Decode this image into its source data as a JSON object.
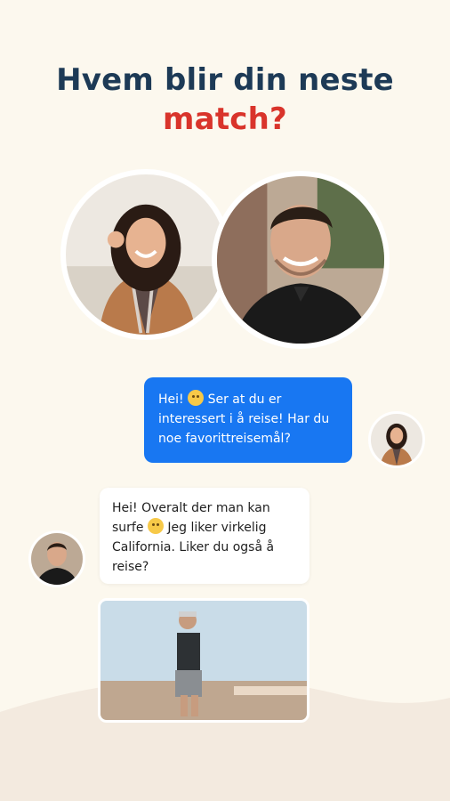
{
  "header": {
    "title_line1": "Hvem blir din neste",
    "title_line2": "match?"
  },
  "chat": {
    "outgoing_message": "Hei! ☺ Ser at du er interessert i å reise! Har du noe favoritreisemål?",
    "outgoing_parts": [
      "Hei!",
      "Ser at du er interessert i å reise! Har du noe favorittreisemål?"
    ],
    "incoming_parts": [
      "Hei! Overalt der man kan surfe",
      "Jeg liker virkelig California. Liker du også å reise?"
    ]
  },
  "images": {
    "match_woman": "woman-profile-photo",
    "match_man": "man-profile-photo",
    "shared_photo": "beach-photo"
  },
  "colors": {
    "background": "#FCF8EE",
    "title_dark": "#1D3A56",
    "title_accent": "#D9342B",
    "outgoing_bubble": "#1877F2",
    "incoming_bubble": "#FFFFFF"
  }
}
